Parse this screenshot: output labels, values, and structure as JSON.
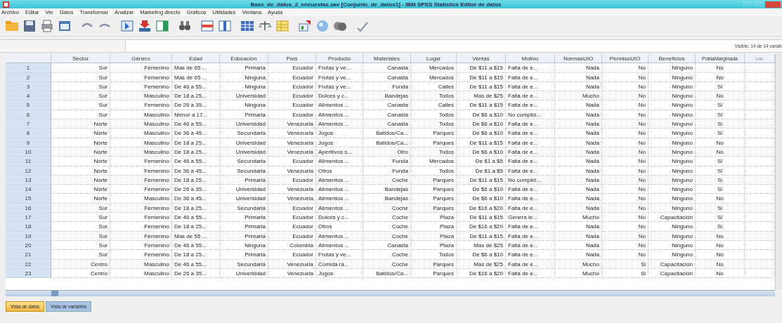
{
  "window": {
    "title": "Base_de_datos_2_encuestas.sav [Conjunto_de_datos1] - IBM SPSS Statistics Editor de datos"
  },
  "menu": [
    "Archivo",
    "Editar",
    "Ver",
    "Datos",
    "Transformar",
    "Analizar",
    "Marketing directo",
    "Gráficos",
    "Utilidades",
    "Ventana",
    "Ayuda"
  ],
  "visible_info": "Visible: 14 de 14 variab",
  "table": {
    "columns": [
      {
        "label": "Sector",
        "kind": "string"
      },
      {
        "label": "Género",
        "kind": "string"
      },
      {
        "label": "Edad",
        "kind": "label"
      },
      {
        "label": "Educación",
        "kind": "string"
      },
      {
        "label": "País",
        "kind": "string"
      },
      {
        "label": "Producto",
        "kind": "label"
      },
      {
        "label": "Materiales",
        "kind": "string"
      },
      {
        "label": "Lugar",
        "kind": "string"
      },
      {
        "label": "Ventas",
        "kind": "string"
      },
      {
        "label": "Motivo",
        "kind": "label"
      },
      {
        "label": "NormasUIO",
        "kind": "string"
      },
      {
        "label": "PermisoUIO",
        "kind": "string"
      },
      {
        "label": "Beneficios",
        "kind": "string"
      },
      {
        "label": "PoblaMarginada",
        "kind": "center"
      },
      {
        "label": "var",
        "kind": "empty"
      }
    ],
    "rows": [
      {
        "number": "1",
        "cells": [
          "Sur",
          "Femenino",
          "Mas de 65 ...",
          "Primaria",
          "Ecuador",
          "Frutas y ve...",
          "Canasta",
          "Mercados",
          "De $11 a $15",
          "Falta de e...",
          "Nada",
          "No",
          "Ninguno",
          "No"
        ]
      },
      {
        "number": "2",
        "cells": [
          "Sur",
          "Femenino",
          "Mas de 65 ...",
          "Ninguna",
          "Ecuador",
          "Frutas y ve...",
          "Canasta",
          "Mercados",
          "De $11 a $15",
          "Falta de e...",
          "Nada",
          "No",
          "Ninguno",
          "No"
        ]
      },
      {
        "number": "3",
        "cells": [
          "Sur",
          "Femenino",
          "De 46 a 55...",
          "Ninguna",
          "Ecuador",
          "Frutas y ve...",
          "Funda",
          "Calles",
          "De $11 a $15",
          "Falta de e...",
          "Nada",
          "No",
          "Ninguno",
          "Si"
        ]
      },
      {
        "number": "4",
        "cells": [
          "Sur",
          "Masculino",
          "De 18 a 25...",
          "Universidad",
          "Ecuador",
          "Dulces y c...",
          "Bandejas",
          "Todos",
          "Mas de $25",
          "Falta de e...",
          "Mucho",
          "No",
          "Ninguno",
          "No"
        ]
      },
      {
        "number": "5",
        "cells": [
          "Sur",
          "Femenino",
          "De 26 a 35...",
          "Ninguna",
          "Ecuador",
          "Alimentos ...",
          "Canasta",
          "Calles",
          "De $11 a $15",
          "Falta de e...",
          "Nada",
          "No",
          "Ninguno",
          "Si"
        ]
      },
      {
        "number": "6",
        "cells": [
          "Sur",
          "Masculino",
          "Menor a 17...",
          "Primaria",
          "Ecuador",
          "Alimentos ...",
          "Canasta",
          "Todos",
          "De $6 a $10",
          "No cumplid...",
          "Nada",
          "No",
          "Ninguno",
          "Si"
        ]
      },
      {
        "number": "7",
        "cells": [
          "Norte",
          "Masculino",
          "De 46 a 55...",
          "Universidad",
          "Venezuela",
          "Alimentos ...",
          "Canasta",
          "Todos",
          "De $6 a $10",
          "Falta de e...",
          "Nada",
          "No",
          "Ninguno",
          "Si"
        ]
      },
      {
        "number": "8",
        "cells": [
          "Norte",
          "Masculino",
          "De 36 a 45...",
          "Secundaria",
          "Venezuela",
          "Jugos",
          "Batidos/Ca...",
          "Parques",
          "De $6 a $10",
          "Falta de e...",
          "Nada",
          "No",
          "Ninguno",
          "Si"
        ]
      },
      {
        "number": "9",
        "cells": [
          "Norte",
          "Masculino",
          "De 18 a 25...",
          "Universidad",
          "Venezuela",
          "Jugos",
          "Batidos/Ca...",
          "Parques",
          "De $11 a $15",
          "Falta de e...",
          "Nada",
          "No",
          "Ninguno",
          "No"
        ]
      },
      {
        "number": "10",
        "cells": [
          "Norte",
          "Masculino",
          "De 18 a 25...",
          "Universidad",
          "Venezuela",
          "Aperitivos s...",
          "Otro",
          "Todos",
          "De $6 a $10",
          "Falta de e...",
          "Nada",
          "No",
          "Ninguno",
          "No"
        ]
      },
      {
        "number": "11",
        "cells": [
          "Norte",
          "Femenino",
          "De 46 a 55...",
          "Secundaria",
          "Ecuador",
          "Alimentos ...",
          "Funda",
          "Mercados",
          "De $1 a $5",
          "Falta de e...",
          "Nada",
          "No",
          "Ninguno",
          "Si"
        ]
      },
      {
        "number": "12",
        "cells": [
          "Norte",
          "Femenino",
          "De 36 a 45...",
          "Secundaria",
          "Venezuela",
          "Otros",
          "Funda",
          "Todos",
          "De $1 a $5",
          "Falta de e...",
          "Nada",
          "No",
          "Ninguno",
          "Si"
        ]
      },
      {
        "number": "13",
        "cells": [
          "Norte",
          "Femenino",
          "De 18 a 25...",
          "Primaria",
          "Ecuador",
          "Alimentos ...",
          "Coche",
          "Parques",
          "De $11 a $15",
          "No cumplid...",
          "Nada",
          "No",
          "Ninguno",
          "Si"
        ]
      },
      {
        "number": "14",
        "cells": [
          "Norte",
          "Femenino",
          "De 26 a 35...",
          "Universidad",
          "Venezuela",
          "Alimentos ...",
          "Bandejas",
          "Parques",
          "De $6 a $10",
          "Falta de e...",
          "Nada",
          "No",
          "Ninguno",
          "Si"
        ]
      },
      {
        "number": "15",
        "cells": [
          "Norte",
          "Masculino",
          "De 36 a 45...",
          "Universidad",
          "Venezuela",
          "Alimentos ...",
          "Bandejas",
          "Parques",
          "De $6 a $10",
          "Falta de e...",
          "Nada",
          "No",
          "Ninguno",
          "No"
        ]
      },
      {
        "number": "16",
        "cells": [
          "Sur",
          "Femenino",
          "De 18 a 25...",
          "Secundaria",
          "Ecuador",
          "Alimentos ...",
          "Coche",
          "Parques",
          "De $16 a $20",
          "Falta de e...",
          "Nada",
          "No",
          "Ninguno",
          "Si"
        ]
      },
      {
        "number": "17",
        "cells": [
          "Sur",
          "Femenino",
          "De 46 a 55...",
          "Primaria",
          "Ecuador",
          "Dulces y c...",
          "Coche",
          "Plaza",
          "De $11 a $15",
          "Genera le...",
          "Mucho",
          "No",
          "Capacitación",
          "Si"
        ]
      },
      {
        "number": "18",
        "cells": [
          "Sur",
          "Femenino",
          "De 18 a 25...",
          "Primaria",
          "Ecuador",
          "Otros",
          "Coche",
          "Plaza",
          "De $16 a $20",
          "Falta de e...",
          "Nada",
          "No",
          "Ninguno",
          "Si"
        ]
      },
      {
        "number": "19",
        "cells": [
          "Sur",
          "Femenino",
          "Mas de 55 ...",
          "Primaria",
          "Ecuador",
          "Alimentos ...",
          "Coche",
          "Plaza",
          "De $11 a $15",
          "Falta de e...",
          "Nada",
          "No",
          "Ninguno",
          "No"
        ]
      },
      {
        "number": "20",
        "cells": [
          "Sur",
          "Femenino",
          "De 46 a 55...",
          "Ninguna",
          "Colombia",
          "Alimentos ...",
          "Canasta",
          "Plaza",
          "Mas de $25",
          "Falta de e...",
          "Nada",
          "No",
          "Ninguno",
          "No"
        ]
      },
      {
        "number": "21",
        "cells": [
          "Sur",
          "Femenino",
          "De 18 a 25...",
          "Primaria",
          "Ecuador",
          "Frutas y ve...",
          "Coche",
          "Todos",
          "De $6 a $10",
          "Falta de e...",
          "Nada",
          "No",
          "Ninguno",
          "No"
        ]
      },
      {
        "number": "22",
        "cells": [
          "Centro",
          "Masculino",
          "De 46 a 55...",
          "Secundaria",
          "Venezuela",
          "Comida rá...",
          "Coche",
          "Parques",
          "Mas de $25",
          "Falta de e...",
          "Mucho",
          "Si",
          "Capacitación",
          "No"
        ]
      },
      {
        "number": "23",
        "cells": [
          "Centro",
          "Masculino",
          "De 26 a 35...",
          "Universidad",
          "Venezuela",
          "Jugos",
          "Batidos/Ca...",
          "Parques",
          "De $16 a $20",
          "Falta de e...",
          "Mucho",
          "Si",
          "Capacitación",
          "No"
        ]
      }
    ]
  },
  "view_tabs": [
    {
      "label": "Vista de datos",
      "selected": true
    },
    {
      "label": "Vista de variables",
      "selected": false
    }
  ]
}
